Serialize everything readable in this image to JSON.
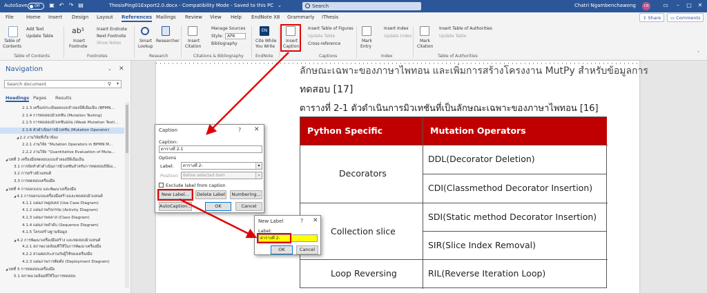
{
  "titlebar": {
    "autosave_label": "AutoSave",
    "autosave_state": "Off",
    "document_title": "ThesisPing01Export2.0.docx - Compatibility Mode - Saved to this PC",
    "title_caret": "⌄",
    "search_placeholder": "Search",
    "user_name": "Chatri Ngambenchawong",
    "user_initials": "CN"
  },
  "tabs": [
    "File",
    "Home",
    "Insert",
    "Design",
    "Layout",
    "References",
    "Mailings",
    "Review",
    "View",
    "Help",
    "EndNote X8",
    "Grammarly",
    "iThesis"
  ],
  "share_label": "Share",
  "comments_label": "Comments",
  "ribbon": {
    "toc": {
      "button": "Table of",
      "button2": "Contents",
      "add_text": "Add Text",
      "update_table": "Update Table",
      "group": "Table of Contents"
    },
    "footnotes": {
      "insert": "Insert",
      "insert2": "Footnote",
      "insert_endnote": "Insert Endnote",
      "next_footnote": "Next Footnote",
      "show_notes": "Show Notes",
      "group": "Footnotes"
    },
    "research": {
      "smart": "Smart",
      "smart2": "Lookup",
      "researcher": "Researcher",
      "group": "Research"
    },
    "citations": {
      "insert": "Insert",
      "insert2": "Citation",
      "manage": "Manage Sources",
      "style_label": "Style:",
      "style_value": "APA",
      "bibliography": "Bibliography",
      "group": "Citations & Bibliography"
    },
    "endnote": {
      "cite": "Cite While",
      "cite2": "You Write",
      "group": "EndNote"
    },
    "captions": {
      "insert": "Insert",
      "insert2": "Caption",
      "table_of_figures": "Insert Table of Figures",
      "update_table": "Update Table",
      "cross_reference": "Cross-reference",
      "group": "Captions"
    },
    "index": {
      "mark": "Mark",
      "mark2": "Entry",
      "insert_index": "Insert Index",
      "update_index": "Update Index",
      "group": "Index"
    },
    "authorities": {
      "mark": "Mark",
      "mark2": "Citation",
      "insert": "Insert Table of Authorities",
      "update": "Update Table",
      "group": "Table of Authorities"
    }
  },
  "nav": {
    "title": "Navigation",
    "search_placeholder": "Search document",
    "tabs": [
      "Headings",
      "Pages",
      "Results"
    ],
    "items": [
      "2.1.3 เครื่องประเมินผลแบบจำลองบีพีเอ็มเอ็น (BPMN...",
      "2.1.4 การทดสอบมิวเทชัน (Mutation Testing)",
      "2.1.5 การทดสอบมิวเทชันอ่อน (Weak Mutation Testi...",
      "2.1.6 ตัวดำเนินการมิวเทชัน (Mutation Operator)",
      "2.2 งานวิจัยที่เกี่ยวข้อง",
      "2.2.1 งานวิจัย “Mutation Operators in BPMN M...",
      "2.2.2 งานวิจัย “Quantitative Evaluation of Muta...",
      "บทที่ 3 เครื่องมือทดสอบแบบจำลองบีพีเอ็มเอ็น",
      "3.1 การจัดทำตัวดำเนินการมิวเทชันสำหรับการทดสอบบีพีเอ...",
      "3.2 การสร้างมิวแทนต์",
      "3.3 การทดสอบเครื่องมือ",
      "บทที่ 4 การออกแบบ และพัฒนาเครื่องมือ",
      "4.1 การออกแบบเครื่องมือสร้างและทดสอบมิวแทนต์",
      "4.1.1 แผนภาพยูสเคส (Use Case Diagram)",
      "4.1.2 แผนภาพกิจกรรม (Activity Diagram)",
      "4.1.3 แผนภาพคลาส (Class Diagram)",
      "4.1.4 แผนภาพลำดับ (Sequence Diagram)",
      "4.1.5 โครงสร้างฐานข้อมูล",
      "4.2 การพัฒนาเครื่องมือสร้าง และทดสอบมิวแทนต์",
      "4.2.1 สภาพแวดล้อมที่ใช้ในการพัฒนาเครื่องมือ",
      "4.2.2 ส่วนต่อประสานกับผู้ใช้ของเครื่องมือ",
      "4.2.3 แผนภาพการติดตั้ง (Deployment Diagram)",
      "บทที่ 5 การทดสอบเครื่องมือ",
      "5.1 สภาพแวดล้อมที่ใช้ในการทดสอบ"
    ]
  },
  "document": {
    "line1": "ลักษณะเฉพาะของภาษาไพทอน และเพิ่มการสร้างโครงงาน MutPy สำหรับข้อมูลการ",
    "line2": "ทดสอบ [17]",
    "table_caption": "ตารางที่ 2-1 ตัวดำเนินการมิวเทชันที่เป็นลักษณะเฉพาะของภาษาไพทอน [16]",
    "table": {
      "headers": [
        "Python Specific Feature",
        "Mutation Operators"
      ],
      "rows": [
        {
          "feature": "Decorators",
          "operators": [
            "DDL(Decorator Deletion)",
            "CDI(Classmethod Decorator Insertion)"
          ]
        },
        {
          "feature": "Collection slice",
          "operators": [
            "SDI(Static method Decorator Insertion)",
            "SIR(Slice Index Removal)"
          ]
        },
        {
          "feature": "Loop Reversing",
          "operators": [
            "RIL(Reverse Iteration Loop)"
          ]
        }
      ]
    }
  },
  "caption_dialog": {
    "title": "Caption",
    "caption_label": "Caption:",
    "caption_value": "ตารางที่ 2-1",
    "options_label": "Options",
    "label_label": "Label:",
    "label_value": "ตารางที่ 2-",
    "position_label": "Position:",
    "position_value": "Below selected item",
    "exclude_label": "Exclude label from caption",
    "new_label_btn": "New Label...",
    "delete_label_btn": "Delete Label",
    "numbering_btn": "Numbering...",
    "autocaption_btn": "AutoCaption...",
    "ok_btn": "OK",
    "cancel_btn": "Cancel"
  },
  "newlabel_dialog": {
    "title": "New Label",
    "label_label": "Label:",
    "label_value": "ตารางที่ 2-",
    "ok_btn": "OK",
    "cancel_btn": "Cancel"
  },
  "colors": {
    "accent": "#2b579a",
    "table_header": "#c00000",
    "highlight": "#e00000",
    "input_highlight": "#ffff00"
  }
}
